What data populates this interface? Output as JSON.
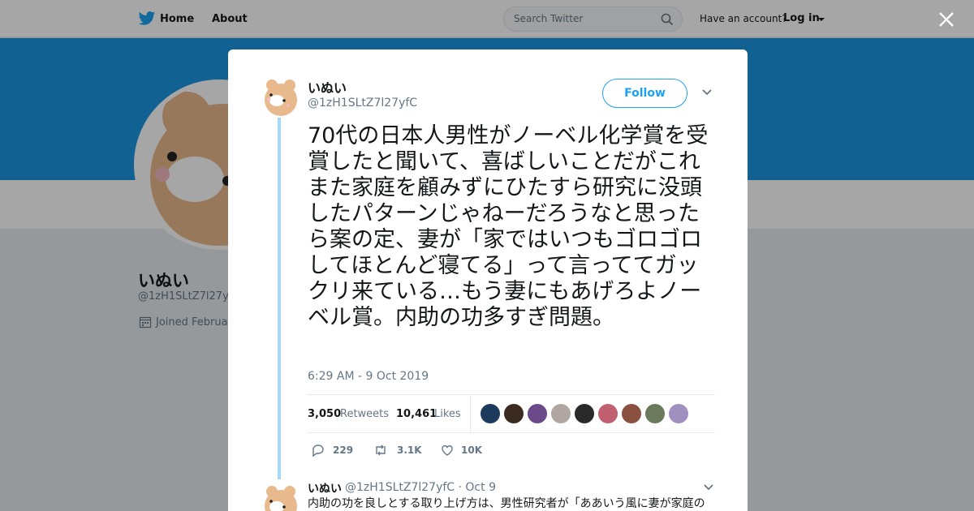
{
  "nav": {
    "home": "Home",
    "about": "About",
    "search_placeholder": "Search Twitter",
    "have_account": "Have an account?",
    "login": "Log in"
  },
  "profile": {
    "name": "いぬい",
    "handle": "@1zH1SLtZ7l27y",
    "joined": "Joined Februa"
  },
  "tweet": {
    "name": "いぬい",
    "handle": "@1zH1SLtZ7l27yfC",
    "follow_label": "Follow",
    "text": "70代の日本人男性がノーベル化学賞を受賞したと聞いて、喜ばしいことだがこれまた家庭を顧みずにひたすら研究に没頭したパターンじゃねーだろうなと思ったら案の定、妻が「家ではいつもゴロゴロしてほとんど寝てる」って言っててガックリ来ている…もう妻にもあげろよノーベル賞。内助の功多すぎ問題。",
    "timestamp": "6:29 AM - 9 Oct 2019",
    "retweets_count": "3,050",
    "retweets_label": "Retweets",
    "likes_count": "10,461",
    "likes_label": "Likes",
    "reply_count": "229",
    "retweet_short": "3.1K",
    "like_short": "10K"
  },
  "reply": {
    "name": "いぬい",
    "meta": "@1zH1SLtZ7l27yfC · Oct 9",
    "text": "内助の功を良しとする取り上げ方は、男性研究者が「ああいう風に妻が家庭の"
  },
  "colors": {
    "accent": "#1da1f2",
    "banner": "#1b95e0",
    "thread": "#a5d8f6"
  },
  "likers": [
    "#1b3a5c",
    "#3a2a20",
    "#6a4a8a",
    "#b0a8a0",
    "#2a2a2a",
    "#c06070",
    "#8a5040",
    "#6a7a5a",
    "#a090c0"
  ]
}
